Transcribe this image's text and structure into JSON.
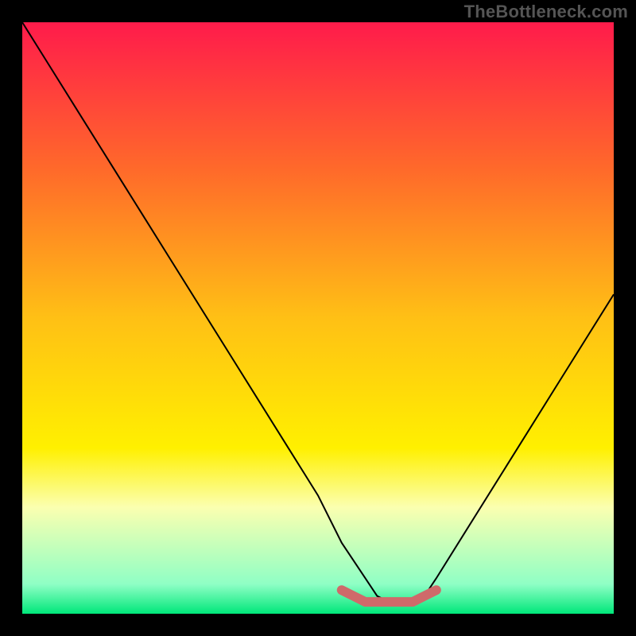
{
  "watermark": "TheBottleneck.com",
  "chart_data": {
    "type": "line",
    "title": "",
    "xlabel": "",
    "ylabel": "",
    "xlim": [
      0,
      100
    ],
    "ylim": [
      0,
      100
    ],
    "background_gradient": {
      "stops": [
        {
          "offset": 0,
          "color": "#ff1b4b"
        },
        {
          "offset": 25,
          "color": "#ff6a2a"
        },
        {
          "offset": 50,
          "color": "#ffc015"
        },
        {
          "offset": 72,
          "color": "#fff000"
        },
        {
          "offset": 82,
          "color": "#fbffb0"
        },
        {
          "offset": 95,
          "color": "#8fffc5"
        },
        {
          "offset": 100,
          "color": "#00e77a"
        }
      ]
    },
    "series": [
      {
        "name": "bottleneck-curve",
        "color": "#000000",
        "x": [
          0,
          5,
          10,
          15,
          20,
          25,
          30,
          35,
          40,
          45,
          50,
          54,
          58,
          60,
          62,
          64,
          66,
          68,
          70,
          75,
          80,
          85,
          90,
          95,
          100
        ],
        "y": [
          100,
          92,
          84,
          76,
          68,
          60,
          52,
          44,
          36,
          28,
          20,
          12,
          6,
          3,
          2,
          2,
          2,
          3,
          6,
          14,
          22,
          30,
          38,
          46,
          54
        ]
      },
      {
        "name": "optimal-marker",
        "color": "#cf6a6a",
        "x": [
          54,
          56,
          58,
          60,
          62,
          64,
          66,
          68,
          70
        ],
        "y": [
          4,
          3,
          2,
          2,
          2,
          2,
          2,
          3,
          4
        ]
      }
    ],
    "annotations": []
  }
}
